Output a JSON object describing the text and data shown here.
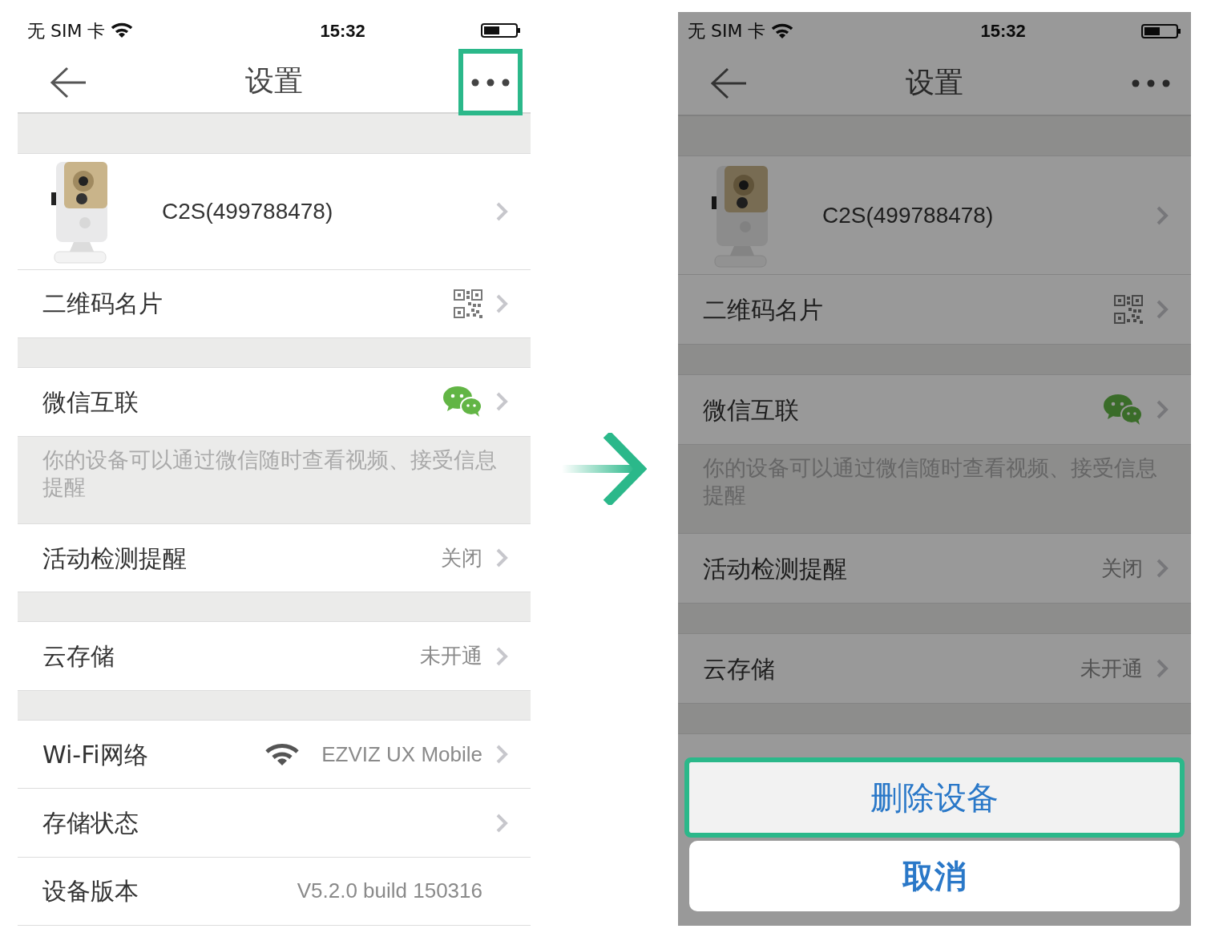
{
  "screens": [
    {
      "dimmed": false,
      "status_bar": {
        "carrier": "无 SIM 卡",
        "time": "15:32"
      },
      "nav": {
        "title": "设置",
        "more_highlighted": true
      },
      "items": [
        {
          "kind": "gap"
        },
        {
          "kind": "device",
          "label": "C2S(499788478)",
          "chevron": true
        },
        {
          "kind": "qr_row",
          "label": "二维码名片",
          "chevron": true
        },
        {
          "kind": "gap"
        },
        {
          "kind": "wechat_row",
          "label": "微信互联",
          "chevron": true
        },
        {
          "kind": "note",
          "text": "你的设备可以通过微信随时查看视频、接受信息提醒"
        },
        {
          "kind": "row",
          "label": "活动检测提醒",
          "value": "关闭",
          "chevron": true
        },
        {
          "kind": "gap"
        },
        {
          "kind": "row",
          "label": "云存储",
          "value": "未开通",
          "chevron": true
        },
        {
          "kind": "gap"
        },
        {
          "kind": "wifi_row",
          "label": "Wi-Fi网络",
          "value": "EZVIZ UX Mobile",
          "chevron": true
        },
        {
          "kind": "row",
          "label": "存储状态",
          "chevron": true
        },
        {
          "kind": "row",
          "label": "设备版本",
          "value": "V5.2.0 build 150316",
          "chevron": false
        }
      ]
    },
    {
      "dimmed": true,
      "status_bar": {
        "carrier": "无 SIM 卡",
        "time": "15:32"
      },
      "nav": {
        "title": "设置",
        "more_highlighted": false
      },
      "items": [
        {
          "kind": "gap"
        },
        {
          "kind": "device",
          "label": "C2S(499788478)",
          "chevron": true
        },
        {
          "kind": "qr_row",
          "label": "二维码名片",
          "chevron": true
        },
        {
          "kind": "gap"
        },
        {
          "kind": "wechat_row",
          "label": "微信互联",
          "chevron": true
        },
        {
          "kind": "note",
          "text": "你的设备可以通过微信随时查看视频、接受信息提醒"
        },
        {
          "kind": "row",
          "label": "活动检测提醒",
          "value": "关闭",
          "chevron": true
        },
        {
          "kind": "gap"
        },
        {
          "kind": "row",
          "label": "云存储",
          "value": "未开通",
          "chevron": true
        },
        {
          "kind": "gap"
        }
      ],
      "action_sheet": [
        {
          "label": "删除设备",
          "highlighted": true
        },
        {
          "label": "取消",
          "highlighted": false
        }
      ]
    }
  ]
}
